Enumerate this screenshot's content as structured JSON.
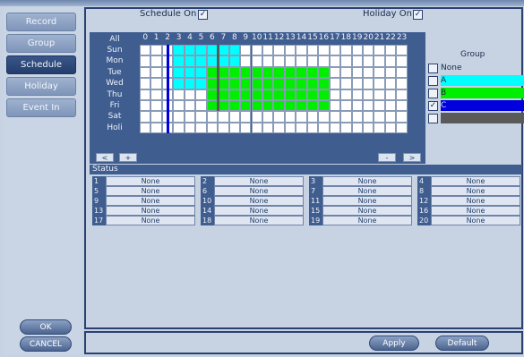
{
  "nav": {
    "items": [
      {
        "label": "Record",
        "active": false
      },
      {
        "label": "Group",
        "active": false
      },
      {
        "label": "Schedule",
        "active": true
      },
      {
        "label": "Holiday",
        "active": false
      },
      {
        "label": "Event In",
        "active": false
      }
    ],
    "ok_label": "OK",
    "cancel_label": "CANCEL"
  },
  "header": {
    "schedule_on_label": "Schedule On",
    "schedule_on_checked": true,
    "holiday_on_label": "Holiday On",
    "holiday_on_checked": true
  },
  "grid": {
    "all_label": "All",
    "hours": [
      "0",
      "1",
      "2",
      "3",
      "4",
      "5",
      "6",
      "7",
      "8",
      "9",
      "10",
      "11",
      "12",
      "13",
      "14",
      "15",
      "16",
      "17",
      "18",
      "19",
      "20",
      "21",
      "22",
      "23"
    ],
    "days": [
      "Sun",
      "Mon",
      "Tue",
      "Wed",
      "Thu",
      "Fri",
      "Sat",
      "Holi"
    ],
    "nav_prev": "<",
    "nav_add": "+",
    "nav_minus": "-",
    "nav_next": ">"
  },
  "group": {
    "title": "Group",
    "options": [
      {
        "label": "None",
        "checked": false,
        "color": ""
      },
      {
        "label": "A",
        "checked": false,
        "color": "#00ffff"
      },
      {
        "label": "B",
        "checked": false,
        "color": "#00ee00"
      },
      {
        "label": "C",
        "checked": true,
        "color": "#0000dd"
      },
      {
        "label": "",
        "checked": false,
        "color": "#5a5a5a"
      }
    ]
  },
  "status": {
    "title": "Status",
    "entries": [
      {
        "num": "1",
        "value": "None"
      },
      {
        "num": "2",
        "value": "None"
      },
      {
        "num": "3",
        "value": "None"
      },
      {
        "num": "4",
        "value": "None"
      },
      {
        "num": "5",
        "value": "None"
      },
      {
        "num": "6",
        "value": "None"
      },
      {
        "num": "7",
        "value": "None"
      },
      {
        "num": "8",
        "value": "None"
      },
      {
        "num": "9",
        "value": "None"
      },
      {
        "num": "10",
        "value": "None"
      },
      {
        "num": "11",
        "value": "None"
      },
      {
        "num": "12",
        "value": "None"
      },
      {
        "num": "13",
        "value": "None"
      },
      {
        "num": "14",
        "value": "None"
      },
      {
        "num": "15",
        "value": "None"
      },
      {
        "num": "16",
        "value": "None"
      },
      {
        "num": "17",
        "value": "None"
      },
      {
        "num": "18",
        "value": "None"
      },
      {
        "num": "19",
        "value": "None"
      },
      {
        "num": "20",
        "value": "None"
      }
    ]
  },
  "footer": {
    "apply_label": "Apply",
    "default_label": "Default"
  }
}
